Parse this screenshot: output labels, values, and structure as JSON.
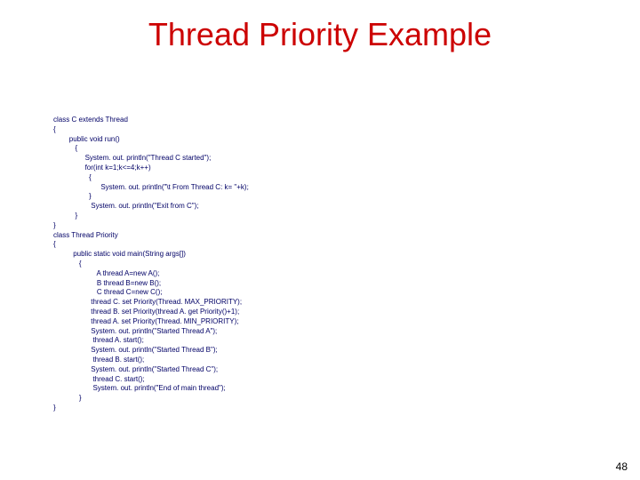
{
  "title": "Thread Priority Example",
  "page_number": "48",
  "code": {
    "l01": "class C extends Thread",
    "l02": "{",
    "l03": "        public void run()",
    "l04": "           {",
    "l05": "                System. out. println(\"Thread C started\");",
    "l06": "                for(int k=1;k<=4;k++)",
    "l07": "                  {",
    "l08": "                        System. out. println(\"\\t From Thread C: k= \"+k);",
    "l09": "                  }",
    "l10": "                   System. out. println(\"Exit from C\");",
    "l11": "           }",
    "l12": "}",
    "l13": "class Thread Priority",
    "l14": "{",
    "l15": "          public static void main(String args[])",
    "l16": "             {",
    "l17": "                      A thread A=new A();",
    "l18": "                      B thread B=new B();",
    "l19": "                      C thread C=new C();",
    "l20": "                   thread C. set Priority(Thread. MAX_PRIORITY);",
    "l21": "                   thread B. set Priority(thread A. get Priority()+1);",
    "l22": "                   thread A. set Priority(Thread. MIN_PRIORITY);",
    "l23": "                   System. out. println(\"Started Thread A\");",
    "l24": "                    thread A. start();",
    "l25": "                   System. out. println(\"Started Thread B\");",
    "l26": "                    thread B. start();",
    "l27": "                   System. out. println(\"Started Thread C\");",
    "l28": "                    thread C. start();",
    "l29": "                    System. out. println(\"End of main thread\");",
    "l30": "             }",
    "l31": "}"
  }
}
